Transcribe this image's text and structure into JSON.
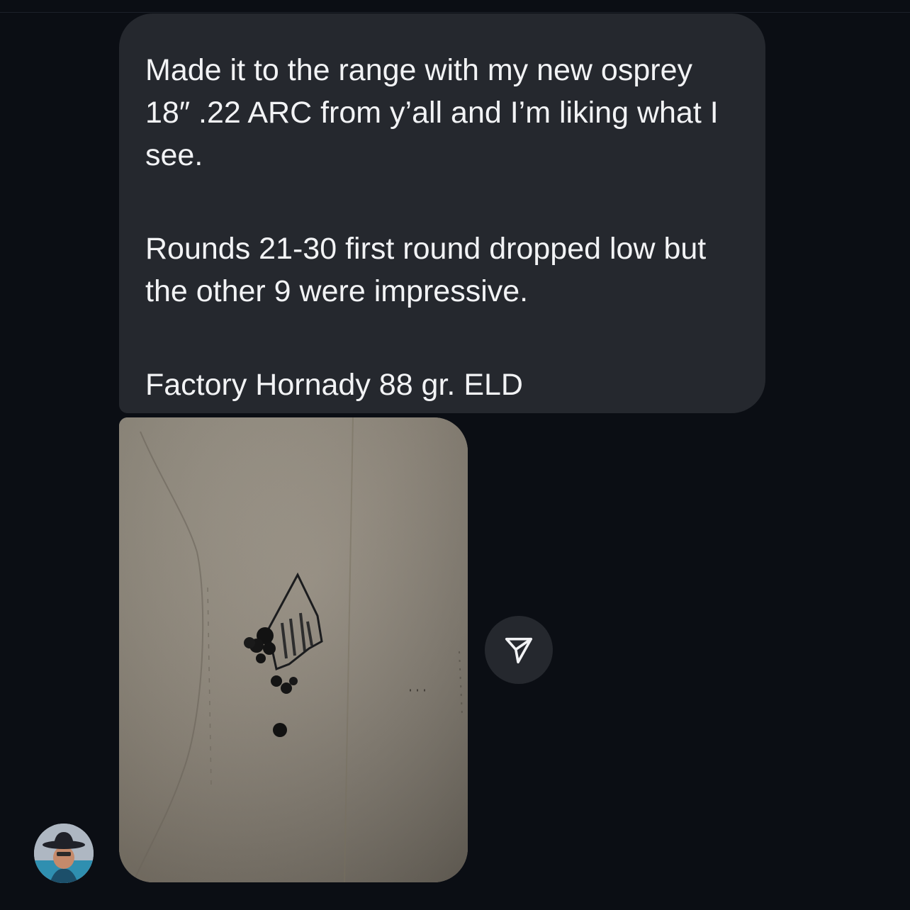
{
  "conversation": {
    "message": {
      "paragraph_1": "Made it to the range with my new osprey 18″ .22 ARC from y’all and I’m liking what I see.",
      "paragraph_2": "Rounds 21-30 first round dropped low but the other 9 were impressive.",
      "paragraph_3": "Factory Hornady 88 gr. ELD"
    },
    "attachment": {
      "kind": "photo",
      "subject": "cardboard target with shot group"
    },
    "share_button": {
      "icon": "send-arrow-icon"
    },
    "sender_avatar": {
      "icon": "profile-photo"
    }
  },
  "colors": {
    "background": "#0b0e14",
    "bubble": "#25282e",
    "text": "#f2f3f5"
  }
}
